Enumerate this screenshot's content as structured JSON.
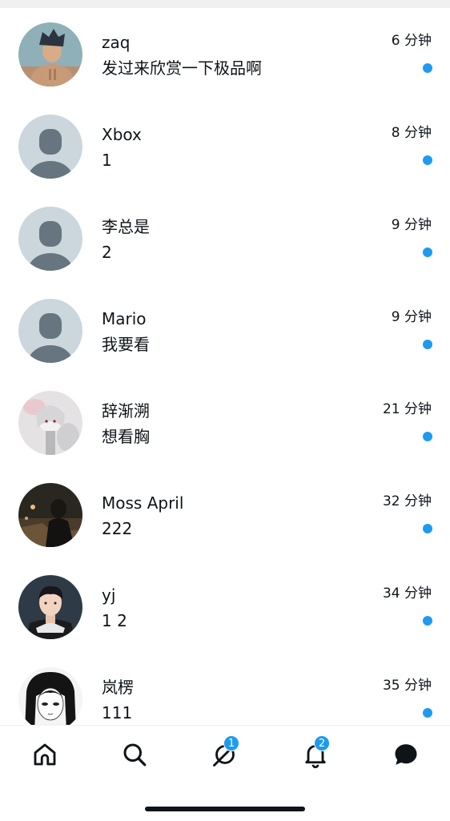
{
  "conversations": [
    {
      "name": "zaq",
      "preview": "发过来欣赏一下极品啊",
      "time": "6 分钟",
      "unread": true,
      "avatar": "photo-man-shirtless-avatar"
    },
    {
      "name": "Xbox",
      "preview": "1",
      "time": "8 分钟",
      "unread": true,
      "avatar": "default-avatar"
    },
    {
      "name": "李总是",
      "preview": "2",
      "time": "9 分钟",
      "unread": true,
      "avatar": "default-avatar"
    },
    {
      "name": "Mario",
      "preview": "我要看",
      "time": "9 分钟",
      "unread": true,
      "avatar": "default-avatar"
    },
    {
      "name": "辞渐溯",
      "preview": "想看胸",
      "time": "21 分钟",
      "unread": true,
      "avatar": "photo-anime-white-hair-avatar"
    },
    {
      "name": "Moss April",
      "preview": "222",
      "time": "32 分钟",
      "unread": true,
      "avatar": "photo-dark-night-avatar"
    },
    {
      "name": "yj",
      "preview": "1 2",
      "time": "34 分钟",
      "unread": true,
      "avatar": "photo-young-man-avatar"
    },
    {
      "name": "岚楞",
      "preview": "111",
      "time": "35 分钟",
      "unread": true,
      "avatar": "photo-manga-girl-avatar"
    }
  ],
  "tabbar": {
    "home": {
      "icon": "home-icon"
    },
    "search": {
      "icon": "search-icon"
    },
    "spaces": {
      "icon": "spaces-icon",
      "badge": "1"
    },
    "notifications": {
      "icon": "bell-icon",
      "badge": "2"
    },
    "messages": {
      "icon": "messages-icon"
    }
  },
  "colors": {
    "accent": "#1d9bf0",
    "text": "#0f1419",
    "default_avatar_bg": "#ccd6dd",
    "default_avatar_fg": "#66757f"
  }
}
